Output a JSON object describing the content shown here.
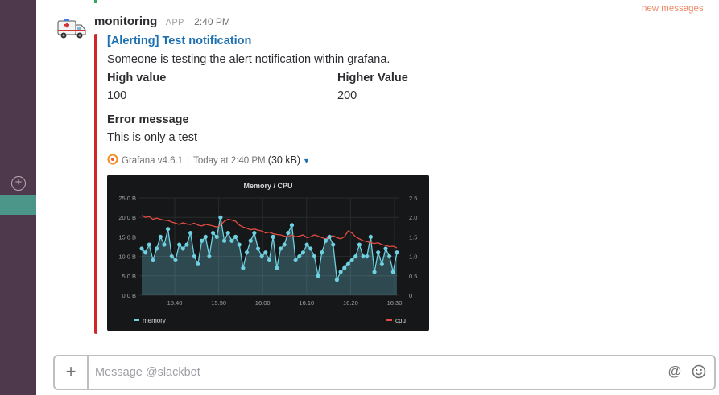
{
  "message": {
    "sender": "monitoring",
    "badge": "APP",
    "time": "2:40 PM"
  },
  "divider": {
    "label": "new messages"
  },
  "attachment": {
    "title": "[Alerting] Test notification",
    "text": "Someone is testing the alert notification within grafana.",
    "fields": [
      {
        "title": "High value",
        "value": "100"
      },
      {
        "title": "Higher Value",
        "value": "200"
      },
      {
        "title": "Error message",
        "value": "This is only a test"
      }
    ],
    "footer": {
      "source": "Grafana v4.6.1",
      "timestamp": "Today at 2:40 PM",
      "size": "(30 kB)"
    },
    "color": "#d0262a"
  },
  "composer": {
    "placeholder": "Message @slackbot"
  },
  "chart_data": {
    "type": "line",
    "title": "Memory / CPU",
    "x_ticks": [
      "15:40",
      "15:50",
      "16:00",
      "16:10",
      "16:20",
      "16:30"
    ],
    "y_left_ticks": [
      "0.0 B",
      "5.0 B",
      "10.0 B",
      "15.0 B",
      "20.0 B",
      "25.0 B"
    ],
    "y_right_ticks": [
      "0",
      "0.5",
      "1.0",
      "1.5",
      "2.0",
      "2.5"
    ],
    "ylim_left": [
      0,
      25
    ],
    "ylim_right": [
      0,
      2.5
    ],
    "legend": "bottom",
    "series": [
      {
        "name": "memory",
        "axis": "left",
        "color": "#6ed0e0",
        "values": [
          12,
          11,
          13,
          9,
          12,
          15,
          13,
          17,
          10,
          9,
          13,
          12,
          13,
          16,
          10,
          8,
          14,
          15,
          10,
          16,
          15,
          20,
          14,
          16,
          14,
          15,
          13,
          7,
          11,
          14,
          16,
          12,
          10,
          11,
          9,
          15,
          7,
          12,
          13,
          16,
          18,
          9,
          10,
          11,
          13,
          12,
          10,
          5,
          11,
          14,
          15,
          13,
          4,
          6,
          7,
          8,
          9,
          10,
          13,
          10,
          10,
          15,
          6,
          11,
          8,
          12,
          10,
          6,
          11
        ]
      },
      {
        "name": "cpu",
        "axis": "right",
        "color": "#e24d42",
        "values": [
          2.05,
          2.0,
          2.02,
          1.95,
          1.98,
          1.95,
          1.93,
          1.92,
          1.88,
          1.85,
          1.82,
          1.86,
          1.83,
          1.82,
          1.85,
          1.8,
          1.78,
          1.82,
          1.8,
          1.78,
          1.75,
          1.8,
          1.9,
          1.95,
          1.93,
          1.9,
          1.8,
          1.75,
          1.72,
          1.68,
          1.7,
          1.67,
          1.65,
          1.6,
          1.62,
          1.58,
          1.56,
          1.55,
          1.52,
          1.5,
          1.55,
          1.5,
          1.52,
          1.55,
          1.48,
          1.5,
          1.55,
          1.52,
          1.48,
          1.45,
          1.5,
          1.53,
          1.48,
          1.45,
          1.5,
          1.65,
          1.6,
          1.5,
          1.45,
          1.4,
          1.38,
          1.35,
          1.33,
          1.35,
          1.3,
          1.28,
          1.25,
          1.26,
          1.22
        ]
      }
    ]
  }
}
